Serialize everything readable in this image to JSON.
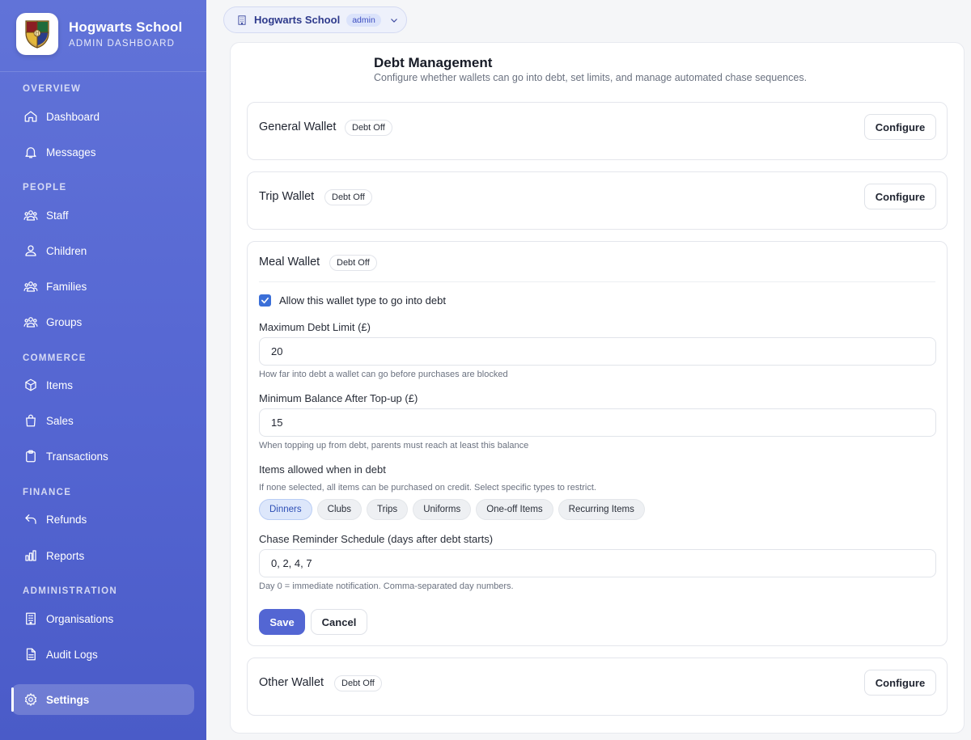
{
  "brand": {
    "title": "Hogwarts School",
    "subtitle": "ADMIN DASHBOARD",
    "logo_icon": "hogwarts-crest"
  },
  "sidebar": {
    "sections": [
      {
        "label": "OVERVIEW"
      },
      {
        "label": "PEOPLE"
      },
      {
        "label": "COMMERCE"
      },
      {
        "label": "FINANCE"
      },
      {
        "label": "ADMINISTRATION"
      }
    ],
    "items": [
      {
        "label": "Dashboard",
        "icon": "home-icon"
      },
      {
        "label": "Messages",
        "icon": "bell-icon"
      },
      {
        "label": "Staff",
        "icon": "users-icon"
      },
      {
        "label": "Children",
        "icon": "user-icon"
      },
      {
        "label": "Families",
        "icon": "users-icon"
      },
      {
        "label": "Groups",
        "icon": "users-icon"
      },
      {
        "label": "Items",
        "icon": "box-icon"
      },
      {
        "label": "Sales",
        "icon": "shopping-bag-icon"
      },
      {
        "label": "Transactions",
        "icon": "clipboard-icon"
      },
      {
        "label": "Refunds",
        "icon": "undo-icon"
      },
      {
        "label": "Reports",
        "icon": "bar-chart-icon"
      },
      {
        "label": "Organisations",
        "icon": "building-icon"
      },
      {
        "label": "Audit Logs",
        "icon": "file-icon"
      },
      {
        "label": "Settings",
        "icon": "gear-icon",
        "active": true
      }
    ]
  },
  "topbar": {
    "school": "Hogwarts School",
    "role": "admin"
  },
  "page": {
    "title": "Debt Management",
    "subtitle": "Configure whether wallets can go into debt, set limits, and manage automated chase sequences."
  },
  "wallets": [
    {
      "name": "General Wallet",
      "status": "Debt Off",
      "action": "Configure"
    },
    {
      "name": "Trip Wallet",
      "status": "Debt Off",
      "action": "Configure"
    },
    {
      "name": "Meal Wallet",
      "status": "Debt Off"
    },
    {
      "name": "Other Wallet",
      "status": "Debt Off",
      "action": "Configure"
    }
  ],
  "meal_form": {
    "allow_debt_label": "Allow this wallet type to go into debt",
    "allow_debt_checked": true,
    "max_debt_label": "Maximum Debt Limit (£)",
    "max_debt_value": "20",
    "max_debt_hint": "How far into debt a wallet can go before purchases are blocked",
    "min_balance_label": "Minimum Balance After Top-up (£)",
    "min_balance_value": "15",
    "min_balance_hint": "When topping up from debt, parents must reach at least this balance",
    "items_label": "Items allowed when in debt",
    "items_hint": "If none selected, all items can be purchased on credit. Select specific types to restrict.",
    "chips": [
      {
        "label": "Dinners",
        "selected": true
      },
      {
        "label": "Clubs",
        "selected": false
      },
      {
        "label": "Trips",
        "selected": false
      },
      {
        "label": "Uniforms",
        "selected": false
      },
      {
        "label": "One-off Items",
        "selected": false
      },
      {
        "label": "Recurring Items",
        "selected": false
      }
    ],
    "schedule_label": "Chase Reminder Schedule (days after debt starts)",
    "schedule_value": "0, 2, 4, 7",
    "schedule_hint": "Day 0 = immediate notification. Comma-separated day numbers.",
    "save_label": "Save",
    "cancel_label": "Cancel"
  },
  "colors": {
    "sidebar": "#5566d2",
    "accent": "#5366d3",
    "checkbox": "#3b6fd8"
  }
}
